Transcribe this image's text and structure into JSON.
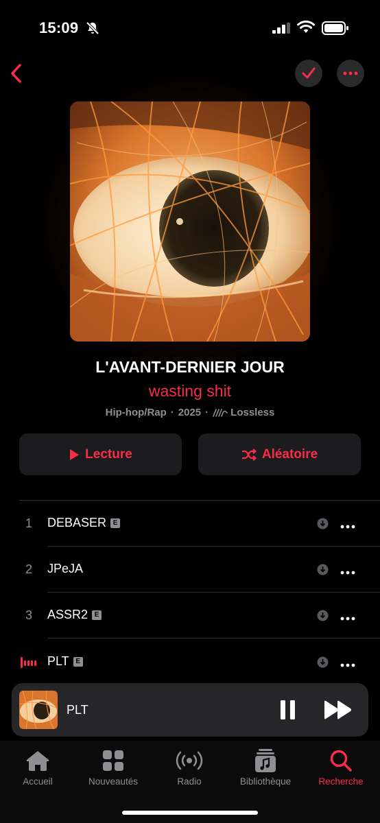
{
  "status": {
    "time": "15:09"
  },
  "header": {
    "back_icon": "chevron-left-icon",
    "checkmark_icon": "checkmark-icon",
    "more_icon": "ellipsis-icon"
  },
  "album": {
    "title": "L'AVANT-DERNIER JOUR",
    "artist": "wasting shit",
    "genre": "Hip-hop/Rap",
    "year": "2025",
    "quality": "Lossless",
    "separator": "·"
  },
  "actions": {
    "play_label": "Lecture",
    "shuffle_label": "Aléatoire"
  },
  "tracks": [
    {
      "number": "1",
      "title": "DEBASER",
      "explicit_badge": "E"
    },
    {
      "number": "2",
      "title": "JPeJA",
      "explicit_badge": ""
    },
    {
      "number": "3",
      "title": "ASSR2",
      "explicit_badge": "E"
    },
    {
      "number": "",
      "title": "PLT",
      "explicit_badge": "E"
    }
  ],
  "mini_player": {
    "title": "PLT"
  },
  "tabs": [
    {
      "label": "Accueil"
    },
    {
      "label": "Nouveautés"
    },
    {
      "label": "Radio"
    },
    {
      "label": "Bibliothèque"
    },
    {
      "label": "Recherche"
    }
  ],
  "colors": {
    "accent": "#fa2d48",
    "background": "#000000",
    "card": "#1c1c1e",
    "secondary_text": "#8e8e93"
  }
}
